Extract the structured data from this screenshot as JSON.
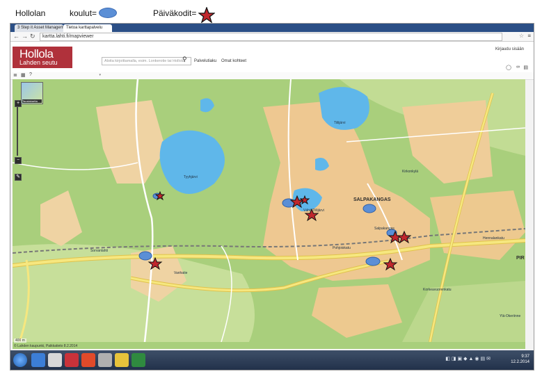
{
  "legend": {
    "title": "Hollolan",
    "schools_label": "koulut=",
    "daycare_label": "Päiväkodit="
  },
  "browser": {
    "tabs": [
      "3 Step it Asset Managem",
      "Tietoa karttapalvelu"
    ],
    "address": "kartta.lahti.fi/mapviewer",
    "star_icon": "☆",
    "menu_icon": "≡"
  },
  "site": {
    "logo_top": "Hollola",
    "logo_bottom": "Lahden seutu",
    "search_placeholder": "Aloita kirjoittamalla, esim. Lonkerotie tai Hollola",
    "menu_help": "Palvelutiaku",
    "menu_other": "Omat kohteet",
    "login": "Kirjaudu sisään"
  },
  "map": {
    "layer_button": "Taustakartta",
    "scale_text": "400 m",
    "copyright": "© Lahden kaupunki, Paikkatieto 8.2.2014",
    "big_labels": [
      "SALPAKANGAS",
      "PIR"
    ],
    "labels": [
      "Tyyhjärvi",
      "Vähä-Tiilijärvi",
      "Tiilijärvi",
      "Kirkonkylä",
      "Hennalankatu",
      "Vanhatie",
      "Korkeavuorenkatu",
      "Pohjoiskatu",
      "Salpakangas",
      "Ylä-Okeriinne",
      "Sorvanlahti"
    ],
    "schools": 6,
    "daycares": 8
  },
  "taskbar": {
    "time": "9:37",
    "date": "12.2.2014",
    "lang": "FI"
  },
  "colors": {
    "school": "#5b8fd6",
    "daycare": "#c0272d",
    "water": "#5fb7ea",
    "forest": "#a9cf7c",
    "urban": "#eec891",
    "road": "#f1e07b"
  }
}
